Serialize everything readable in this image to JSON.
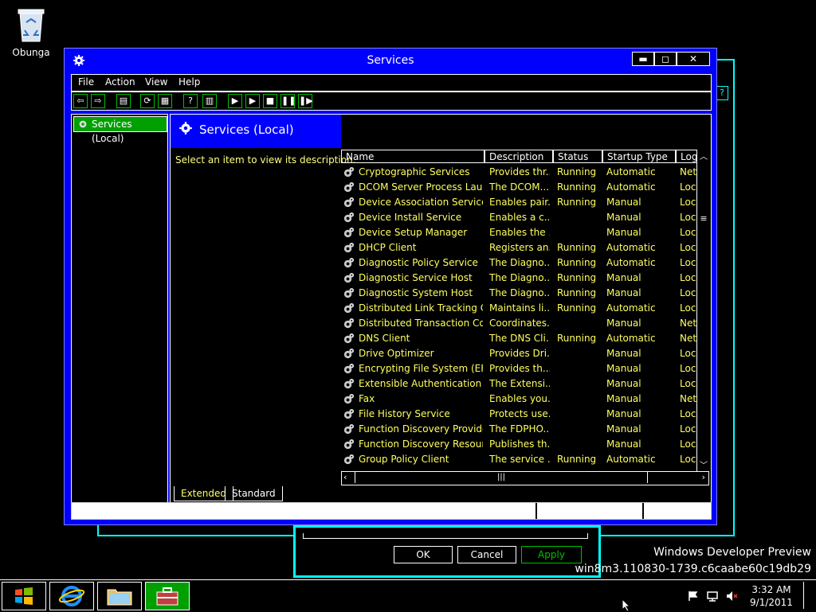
{
  "desktop": {
    "recycle_label": "Obunga",
    "watermark_line1": "Windows Developer Preview",
    "watermark_line2": "win8m3.110830-1739.c6caabe60c19db29"
  },
  "dialog": {
    "ok": "OK",
    "cancel": "Cancel",
    "apply": "Apply",
    "help": "?"
  },
  "window": {
    "title": "Services",
    "menu": [
      "File",
      "Action",
      "View",
      "Help"
    ]
  },
  "tree": {
    "root": "Services (Local)"
  },
  "detail": {
    "header": "Services (Local)",
    "description": "Select an item to view its description."
  },
  "columns": [
    "Name",
    "Description",
    "Status",
    "Startup Type",
    "Log"
  ],
  "services": [
    {
      "name": "Cryptographic Services",
      "desc": "Provides thr...",
      "status": "Running",
      "startup": "Automatic",
      "logon": "Net"
    },
    {
      "name": "DCOM Server Process Laun...",
      "desc": "The DCOM...",
      "status": "Running",
      "startup": "Automatic",
      "logon": "Loc"
    },
    {
      "name": "Device Association Service",
      "desc": "Enables pair...",
      "status": "Running",
      "startup": "Manual",
      "logon": "Loc"
    },
    {
      "name": "Device Install Service",
      "desc": "Enables a c...",
      "status": "",
      "startup": "Manual",
      "logon": "Loc"
    },
    {
      "name": "Device Setup Manager",
      "desc": "Enables the ...",
      "status": "",
      "startup": "Manual",
      "logon": "Loc"
    },
    {
      "name": "DHCP Client",
      "desc": "Registers an...",
      "status": "Running",
      "startup": "Automatic",
      "logon": "Loc"
    },
    {
      "name": "Diagnostic Policy Service",
      "desc": "The Diagno...",
      "status": "Running",
      "startup": "Automatic",
      "logon": "Loc"
    },
    {
      "name": "Diagnostic Service Host",
      "desc": "The Diagno...",
      "status": "Running",
      "startup": "Manual",
      "logon": "Loc"
    },
    {
      "name": "Diagnostic System Host",
      "desc": "The Diagno...",
      "status": "Running",
      "startup": "Manual",
      "logon": "Loc"
    },
    {
      "name": "Distributed Link Tracking Cl...",
      "desc": "Maintains li...",
      "status": "Running",
      "startup": "Automatic",
      "logon": "Loc"
    },
    {
      "name": "Distributed Transaction Co...",
      "desc": "Coordinates...",
      "status": "",
      "startup": "Manual",
      "logon": "Net"
    },
    {
      "name": "DNS Client",
      "desc": "The DNS Cli...",
      "status": "Running",
      "startup": "Automatic",
      "logon": "Net"
    },
    {
      "name": "Drive Optimizer",
      "desc": "Provides Dri...",
      "status": "",
      "startup": "Manual",
      "logon": "Loc"
    },
    {
      "name": "Encrypting File System (EFS)",
      "desc": "Provides th...",
      "status": "",
      "startup": "Manual",
      "logon": "Loc"
    },
    {
      "name": "Extensible Authentication P...",
      "desc": "The Extensi...",
      "status": "",
      "startup": "Manual",
      "logon": "Loc"
    },
    {
      "name": "Fax",
      "desc": "Enables you...",
      "status": "",
      "startup": "Manual",
      "logon": "Net"
    },
    {
      "name": "File History Service",
      "desc": "Protects use...",
      "status": "",
      "startup": "Manual",
      "logon": "Loc"
    },
    {
      "name": "Function Discovery Provide...",
      "desc": "The FDPHO...",
      "status": "",
      "startup": "Manual",
      "logon": "Loc"
    },
    {
      "name": "Function Discovery Resourc...",
      "desc": "Publishes th...",
      "status": "",
      "startup": "Manual",
      "logon": "Loc"
    },
    {
      "name": "Group Policy Client",
      "desc": "The service ...",
      "status": "Running",
      "startup": "Automatic",
      "logon": "Loc"
    }
  ],
  "tabs": [
    "Extended",
    "Standard"
  ],
  "taskbar": {
    "time": "3:32 AM",
    "date": "9/1/2011"
  },
  "colors": {
    "window_blue": "#0000ff",
    "accent_cyan": "#00ffff",
    "active_green": "#00a000",
    "row_text": "#ffff60"
  }
}
